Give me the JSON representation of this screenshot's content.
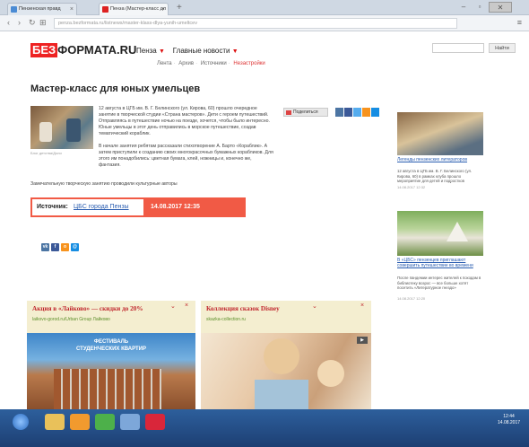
{
  "browser": {
    "tabs": [
      {
        "label": "Пензенская правд",
        "active": false
      },
      {
        "label": "Пенза (Мастер-класс дл",
        "active": true
      }
    ],
    "url": "penza.bezformata.ru/listnews/master-klass-dlya-yunih-umeltcev",
    "colors": {
      "tabbar": "#cfd8e3"
    }
  },
  "site": {
    "logo_red": "БЕЗ",
    "logo_black": "ФОРМАТА.RU",
    "city": "Пенза",
    "main_news": "Главные новости",
    "subnav": [
      "Лента",
      "Архив",
      "Источники",
      "Незастройки"
    ],
    "search_button": "Найти",
    "accent_color": "#e22"
  },
  "article": {
    "title": "Мастер-класс для юных умельцев",
    "image_caption": "Блог детства/Доли",
    "p1": "12 августа в ЦГБ им. В. Г. Белинского (ул. Кирова, 60) прошло очередное занятие в творческой студии «Страна мастеров». Дети с героем путешествий. Отправляясь в путешествие ночью на поезде, хочется, чтобы было интересно. Юные умельцы в этот день отправились в морское путешествие, создав тематический кораблик.",
    "p1_link": "«Страна мастеров»",
    "p2": "В начале занятия ребятам рассказали стихотворение А. Барто «Кораблик». А затем приступили к созданию своих многокрасочных бумажных корабликов. Для этого им понадобились: цветная бумага, клей, ножницы и, конечно же, фантазия.",
    "p3": "Замечательную творческую занятию проводили культурные авторы",
    "share_label": "Поделиться",
    "source_label": "Источник:",
    "source_name": "ЦБС города Пензы",
    "source_date": "14.08.2017 12:35"
  },
  "sidebar": [
    {
      "link": "Легенды пензенских литераторов",
      "text": "12 августа в ЦГБ им. В. Г. Белинского (ул. Кирова, 60) в рамках клуба прошло мероприятие для детей и подростков",
      "date": "14.08.2017 12:32"
    },
    {
      "link": "В «ЦБС» пензенцев приглашают совершить путешествие во времени",
      "text": "После пандемии интерес жителей к походам в библиотеку возрос — все больше хотят посетить «Литературное гнездо»",
      "date": "14.08.2017 12:20"
    }
  ],
  "ads": [
    {
      "title": "Акция в «Лайково» — скидки до 20%",
      "sub": "laikovo-gorod.ru/Urban Group Лайково",
      "image_text_1": "ФЕСТИВАЛЬ",
      "image_text_2": "СТУДЕНЧЕСКИХ КВАРТИР"
    },
    {
      "title": "Коллекция сказок Disney",
      "sub": "skazka-collection.ru"
    }
  ],
  "taskbar": {
    "time": "12:44",
    "date": "14.08.2017"
  }
}
